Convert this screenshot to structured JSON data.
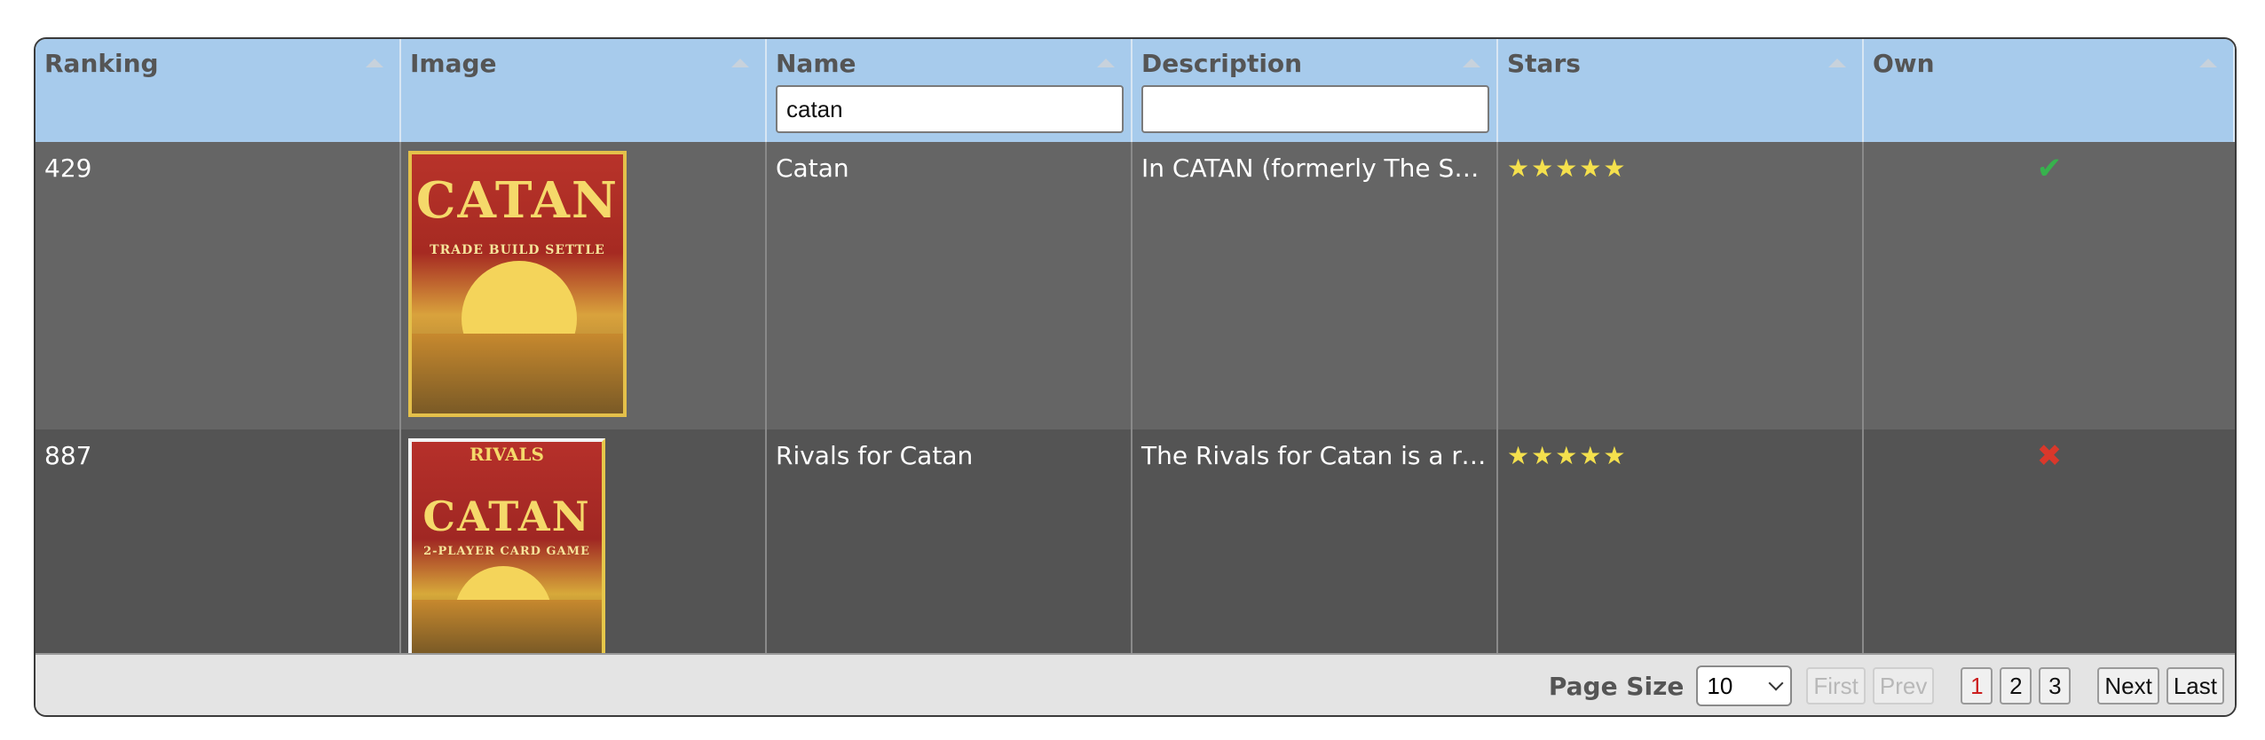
{
  "columns": [
    {
      "label": "Ranking"
    },
    {
      "label": "Image"
    },
    {
      "label": "Name",
      "filter_value": "catan"
    },
    {
      "label": "Description",
      "filter_value": ""
    },
    {
      "label": "Stars"
    },
    {
      "label": "Own"
    }
  ],
  "rows": [
    {
      "ranking": "429",
      "image": {
        "pre": "",
        "title": "CATAN",
        "subtitle": "TRADE BUILD SETTLE"
      },
      "name": "Catan",
      "description": "In CATAN (formerly The Settl…",
      "stars": "★★★★★",
      "own": "✔"
    },
    {
      "ranking": "887",
      "image": {
        "pre": "RIVALS",
        "title": "CATAN",
        "subtitle": "2-PLAYER CARD GAME"
      },
      "name": "Rivals for Catan",
      "description": "The Rivals for Catan is a rei…",
      "stars": "★★★★★",
      "own": "✖"
    }
  ],
  "pagination": {
    "page_size_label": "Page Size",
    "page_size_value": "10",
    "first": "First",
    "prev": "Prev",
    "pages": [
      "1",
      "2",
      "3"
    ],
    "next": "Next",
    "last": "Last"
  }
}
